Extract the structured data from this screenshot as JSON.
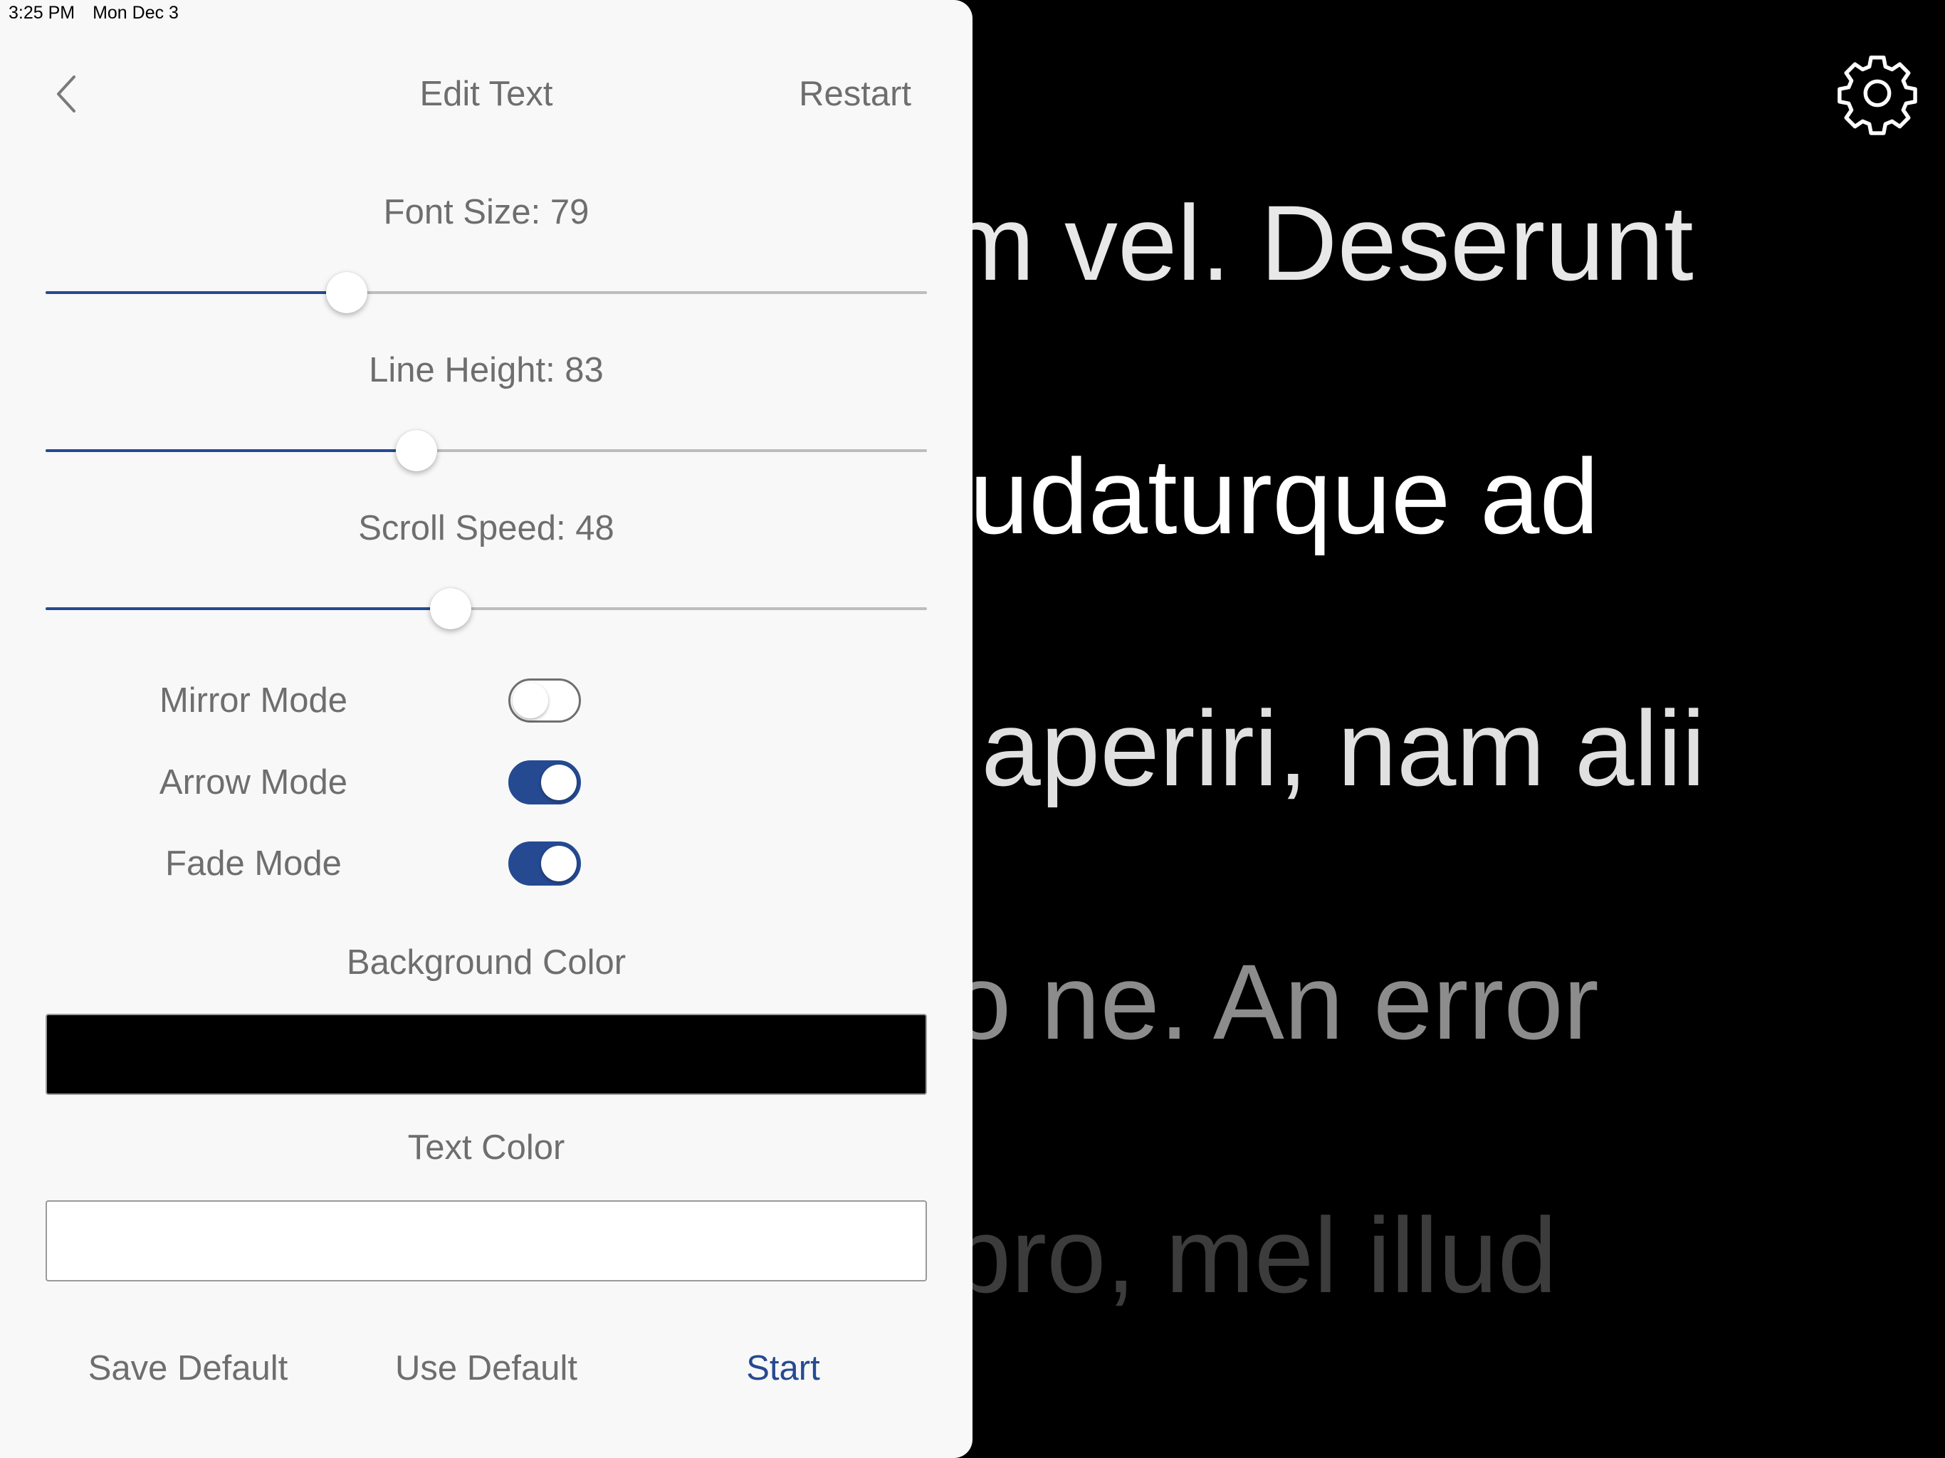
{
  "status_bar": {
    "time": "3:25 PM",
    "date": "Mon Dec 3"
  },
  "nav": {
    "title": "Edit Text",
    "restart_label": "Restart",
    "back_icon": "chevron-left-icon"
  },
  "sliders": [
    {
      "label": "Font Size: 79",
      "fraction": 0.342
    },
    {
      "label": "Line Height: 83",
      "fraction": 0.421
    },
    {
      "label": "Scroll Speed: 48",
      "fraction": 0.46
    }
  ],
  "toggles": [
    {
      "label": "Mirror Mode",
      "on": false
    },
    {
      "label": "Arrow Mode",
      "on": true
    },
    {
      "label": "Fade Mode",
      "on": true
    }
  ],
  "background_color": {
    "label": "Background Color",
    "value": "#000000"
  },
  "text_color": {
    "label": "Text Color",
    "value": "#ffffff"
  },
  "buttons": {
    "save_default": "Save Default",
    "use_default": "Use Default",
    "start": "Start"
  },
  "colors": {
    "accent": "#254a92",
    "panel_bg": "#f8f8f8",
    "label_gray": "#6e6e6e"
  },
  "prompter": {
    "settings_icon": "gear-icon",
    "lines": [
      {
        "text": "sam vel. Deserunt",
        "color": "#e8e8e8"
      },
      {
        "text": "ncludaturque ad",
        "color": "#ffffff"
      },
      {
        "text": "ior aperiri, nam alii",
        "color": "#e0e0e0"
      },
      {
        "text": "odo ne. An error",
        "color": "#8c8c8c"
      },
      {
        "text": "nt pro, mel illud",
        "color": "#3c3c3c"
      }
    ]
  }
}
